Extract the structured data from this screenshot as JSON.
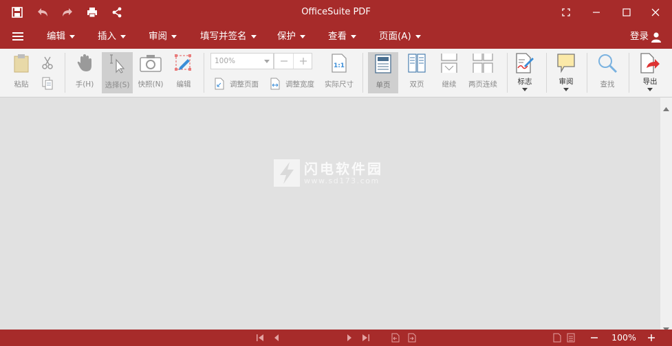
{
  "window": {
    "title": "OfficeSuite PDF"
  },
  "menu": {
    "items": [
      {
        "label": "编辑"
      },
      {
        "label": "插入"
      },
      {
        "label": "审阅"
      },
      {
        "label": "填写并签名"
      },
      {
        "label": "保护"
      },
      {
        "label": "查看"
      },
      {
        "label": "页面(A)"
      }
    ],
    "login_label": "登录"
  },
  "toolbar": {
    "paste": "粘贴",
    "hand": "手(H)",
    "select": "选择(S)",
    "snapshot": "快照(N)",
    "edit": "编辑",
    "zoom_value": "100%",
    "fit_page": "调整页面",
    "fit_width": "调整宽度",
    "actual_size": "实际尺寸",
    "single_page": "单页",
    "two_pages": "双页",
    "continuous": "继续",
    "two_pages_continuous": "两页连续",
    "mark": "标志",
    "review": "审阅",
    "find": "查找",
    "export": "导出"
  },
  "watermark": {
    "title": "闪电软件园",
    "url": "www.sd173.com"
  },
  "status": {
    "zoom": "100%"
  },
  "colors": {
    "accent": "#a72b2a",
    "toolbar_bg": "#f3f3f3",
    "content_bg": "#e1e1e1"
  }
}
